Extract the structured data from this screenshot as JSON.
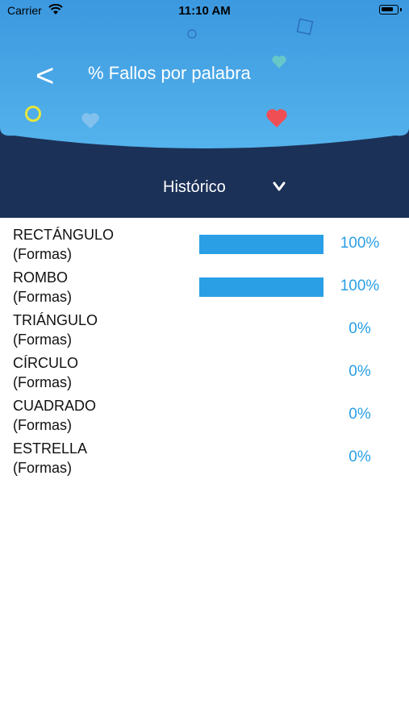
{
  "status_bar": {
    "carrier": "Carrier",
    "time": "11:10 AM"
  },
  "header": {
    "back_label": "<",
    "title": "% Fallos por palabra"
  },
  "filter": {
    "selected": "Histórico",
    "chevron": "v"
  },
  "colors": {
    "sky": "#4aa9e9",
    "navy": "#1c3157",
    "accent": "#2a9fe6",
    "heart": "#f04e55"
  },
  "rows": [
    {
      "word": "RECTÁNGULO",
      "category": "(Formas)",
      "percent": 100,
      "percent_label": "100%"
    },
    {
      "word": "ROMBO",
      "category": "(Formas)",
      "percent": 100,
      "percent_label": "100%"
    },
    {
      "word": "TRIÁNGULO",
      "category": "(Formas)",
      "percent": 0,
      "percent_label": "0%"
    },
    {
      "word": "CÍRCULO",
      "category": "(Formas)",
      "percent": 0,
      "percent_label": "0%"
    },
    {
      "word": "CUADRADO",
      "category": "(Formas)",
      "percent": 0,
      "percent_label": "0%"
    },
    {
      "word": "ESTRELLA",
      "category": "(Formas)",
      "percent": 0,
      "percent_label": "0%"
    }
  ]
}
